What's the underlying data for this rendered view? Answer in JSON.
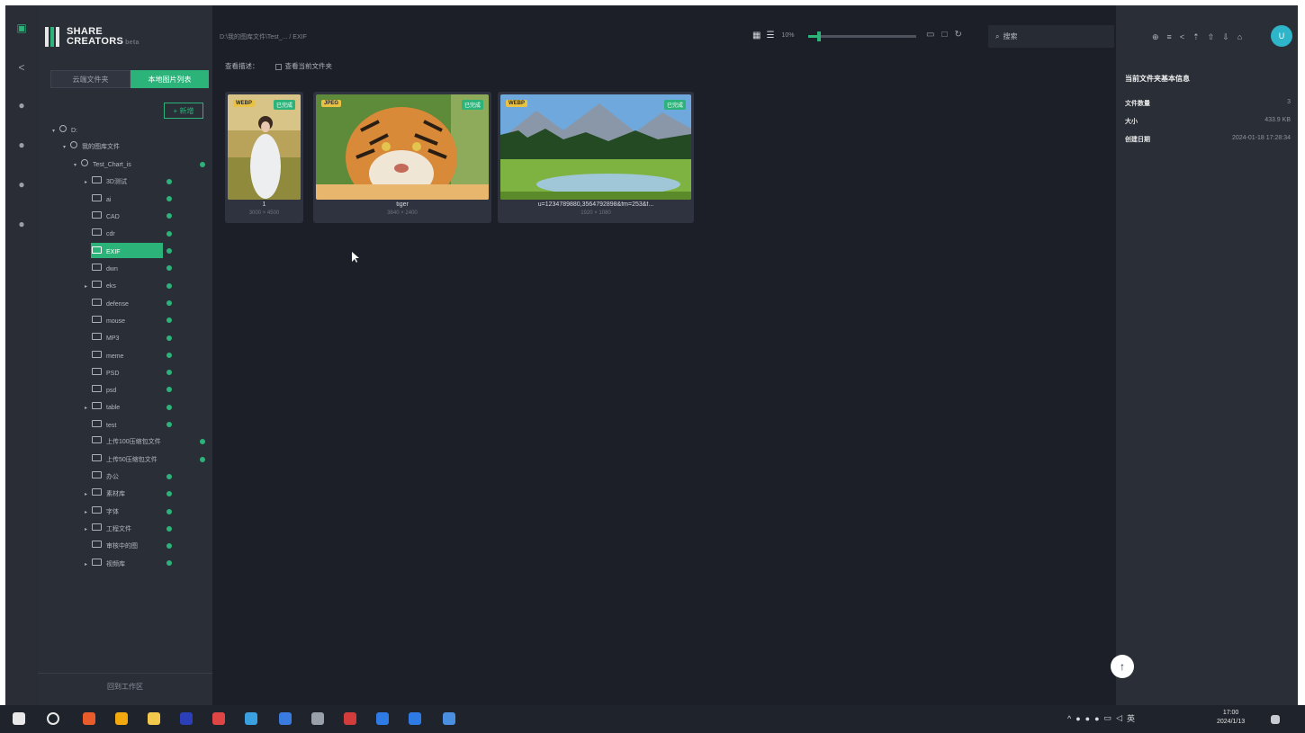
{
  "app": {
    "logo_line1": "SHARE",
    "logo_line2": "CREATORS",
    "logo_sub": "beta"
  },
  "sidebar": {
    "tabs": [
      {
        "label": "云端文件夹",
        "active": false
      },
      {
        "label": "本地图片列表",
        "active": true
      }
    ],
    "add_button": "+ 新增",
    "back_label": "回到工作区"
  },
  "tree": [
    {
      "label": "D:",
      "level": 0,
      "arrow": "▾",
      "kind": "drive",
      "dot": false
    },
    {
      "label": "我的图库文件",
      "level": 1,
      "arrow": "▾",
      "kind": "clock",
      "dot": false
    },
    {
      "label": "Test_Chart_is",
      "level": 2,
      "arrow": "▾",
      "kind": "home",
      "dot": true
    },
    {
      "label": "3D测试",
      "level": 3,
      "arrow": "▸",
      "kind": "folder",
      "dot": true
    },
    {
      "label": "ai",
      "level": 3,
      "arrow": "",
      "kind": "folder",
      "dot": true
    },
    {
      "label": "CAD",
      "level": 3,
      "arrow": "",
      "kind": "folder",
      "dot": true
    },
    {
      "label": "cdr",
      "level": 3,
      "arrow": "",
      "kind": "folder",
      "dot": true
    },
    {
      "label": "EXIF",
      "level": 3,
      "arrow": "",
      "kind": "folder",
      "dot": true,
      "selected": true
    },
    {
      "label": "dwn",
      "level": 3,
      "arrow": "",
      "kind": "folder",
      "dot": true
    },
    {
      "label": "eks",
      "level": 3,
      "arrow": "▸",
      "kind": "folder",
      "dot": true
    },
    {
      "label": "defense",
      "level": 3,
      "arrow": "",
      "kind": "folder",
      "dot": true
    },
    {
      "label": "mouse",
      "level": 3,
      "arrow": "",
      "kind": "folder",
      "dot": true
    },
    {
      "label": "MP3",
      "level": 3,
      "arrow": "",
      "kind": "folder",
      "dot": true
    },
    {
      "label": "meme",
      "level": 3,
      "arrow": "",
      "kind": "folder",
      "dot": true
    },
    {
      "label": "PSD",
      "level": 3,
      "arrow": "",
      "kind": "folder",
      "dot": true
    },
    {
      "label": "psd",
      "level": 3,
      "arrow": "",
      "kind": "folder",
      "dot": true
    },
    {
      "label": "table",
      "level": 3,
      "arrow": "▸",
      "kind": "folder",
      "dot": true
    },
    {
      "label": "test",
      "level": 3,
      "arrow": "",
      "kind": "folder",
      "dot": true
    },
    {
      "label": "上传100压缩包文件",
      "level": 3,
      "arrow": "",
      "kind": "folder",
      "dot": true
    },
    {
      "label": "上传50压缩包文件",
      "level": 3,
      "arrow": "",
      "kind": "folder",
      "dot": true
    },
    {
      "label": "办公",
      "level": 3,
      "arrow": "",
      "kind": "folder",
      "dot": true
    },
    {
      "label": "素材库",
      "level": 3,
      "arrow": "▸",
      "kind": "folder",
      "dot": true
    },
    {
      "label": "字体",
      "level": 3,
      "arrow": "▸",
      "kind": "folder",
      "dot": true
    },
    {
      "label": "工程文件",
      "level": 3,
      "arrow": "▸",
      "kind": "folder",
      "dot": true
    },
    {
      "label": "审核中的图",
      "level": 3,
      "arrow": "",
      "kind": "folder",
      "dot": true
    },
    {
      "label": "视频库",
      "level": 3,
      "arrow": "▸",
      "kind": "folder",
      "dot": true
    }
  ],
  "toolbar": {
    "breadcrumb": "D:\\我的图库文件\\Test_... / EXIF",
    "sub_left": "查看描述：",
    "sub_right": "查看当前文件夹",
    "zoom_label": "10%",
    "search_placeholder": "搜索"
  },
  "cards": [
    {
      "name": "1",
      "dims": "3000 × 4500",
      "format": "WEBP",
      "tag": "已完成"
    },
    {
      "name": "tiger",
      "dims": "3840 × 2400",
      "format": "JPEG",
      "tag": "已完成"
    },
    {
      "name": "u=1234789880,3564792898&fm=253&f...",
      "dims": "1920 × 1080",
      "format": "WEBP",
      "tag": "已完成"
    }
  ],
  "right_panel": {
    "avatar_letter": "U",
    "title": "当前文件夹基本信息",
    "rows": [
      {
        "key": "文件数量",
        "value": "3"
      },
      {
        "key": "大小",
        "value": "433.9 KB"
      },
      {
        "key": "创建日期",
        "value": "2024-01-18 17:28:34"
      }
    ]
  },
  "taskbar": {
    "time": "17:00",
    "date": "2024/1/13",
    "lang": "英"
  },
  "colors": {
    "accent": "#2bb37a",
    "bg": "#1c1f27",
    "panel": "#2a2e37"
  }
}
